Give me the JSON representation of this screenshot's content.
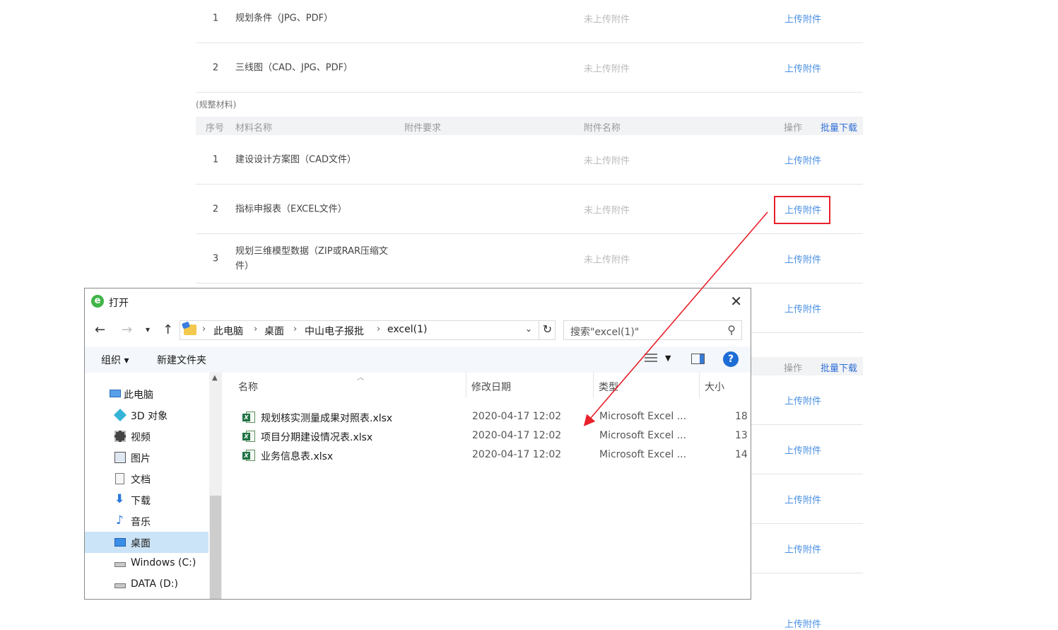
{
  "web": {
    "top_rows": [
      {
        "num": "1",
        "name": "规划条件（JPG、PDF）",
        "attachment": "未上传附件",
        "op": "上传附件"
      },
      {
        "num": "2",
        "name": "三线图（CAD、JPG、PDF）",
        "attachment": "未上传附件",
        "op": "上传附件"
      }
    ],
    "section_label": "(规整材料)",
    "header": {
      "seq": "序号",
      "material": "材料名称",
      "requirement": "附件要求",
      "att_name": "附件名称",
      "op": "操作",
      "bulk": "批量下载"
    },
    "rows": [
      {
        "num": "1",
        "name": "建设设计方案图（CAD文件）",
        "attachment": "未上传附件",
        "op": "上传附件"
      },
      {
        "num": "2",
        "name": "指标申报表（EXCEL文件）",
        "attachment": "未上传附件",
        "op": "上传附件"
      },
      {
        "num": "3",
        "name": "规划三维模型数据（ZIP或RAR压缩文件）",
        "attachment": "未上传附件",
        "op": "上传附件"
      }
    ],
    "hidden_ops": [
      "上传附件",
      "上传附件",
      "上传附件",
      "上传附件",
      "上传附件",
      "上传附件",
      "上传附件"
    ],
    "header2": {
      "op": "操作",
      "bulk": "批量下载"
    }
  },
  "dialog": {
    "title": "打开",
    "app_icon": "e",
    "close_glyph": "✕",
    "breadcrumb": [
      "此电脑",
      "桌面",
      "中山电子报批",
      "excel(1)"
    ],
    "search_placeholder": "搜索\"excel(1)\"",
    "toolbar": {
      "organize": "组织 ▾",
      "new_folder": "新建文件夹"
    },
    "sidebar": [
      {
        "label": "此电脑",
        "icon": "computer-icon"
      },
      {
        "label": "3D 对象",
        "icon": "cube-icon"
      },
      {
        "label": "视频",
        "icon": "video-icon"
      },
      {
        "label": "图片",
        "icon": "picture-icon"
      },
      {
        "label": "文档",
        "icon": "document-icon"
      },
      {
        "label": "下载",
        "icon": "download-icon"
      },
      {
        "label": "音乐",
        "icon": "music-icon"
      },
      {
        "label": "桌面",
        "icon": "desktop-icon"
      },
      {
        "label": "Windows (C:)",
        "icon": "drive-icon"
      },
      {
        "label": "DATA (D:)",
        "icon": "drive-icon"
      }
    ],
    "columns": {
      "name": "名称",
      "modified": "修改日期",
      "type": "类型",
      "size": "大小"
    },
    "files": [
      {
        "name": "规划核实测量成果对照表.xlsx",
        "modified": "2020-04-17 12:02",
        "type": "Microsoft Excel ...",
        "size": "18"
      },
      {
        "name": "项目分期建设情况表.xlsx",
        "modified": "2020-04-17 12:02",
        "type": "Microsoft Excel ...",
        "size": "13"
      },
      {
        "name": "业务信息表.xlsx",
        "modified": "2020-04-17 12:02",
        "type": "Microsoft Excel ...",
        "size": "14"
      }
    ]
  },
  "colors": {
    "link": "#4a90e2",
    "highlight": "#e8212b",
    "selected": "#cce4f7"
  }
}
